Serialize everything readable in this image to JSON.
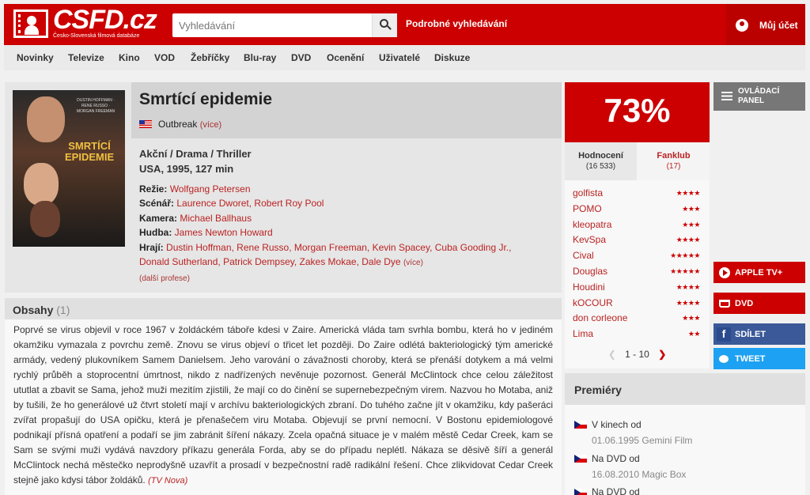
{
  "header": {
    "logo_text": "CSFD.cz",
    "logo_sub": "Česko-Slovenská filmová databáze",
    "search_placeholder": "Vyhledávání",
    "advanced_search": "Podrobné vyhledávání",
    "account": "Můj účet"
  },
  "nav": [
    "Novinky",
    "Televize",
    "Kino",
    "VOD",
    "Žebříčky",
    "Blu-ray",
    "DVD",
    "Ocenění",
    "Uživatelé",
    "Diskuze"
  ],
  "film": {
    "title": "Smrtící epidemie",
    "original_title": "Outbreak",
    "more": "(více)",
    "genre": "Akční / Drama / Thriller",
    "origin": "USA, 1995, 127 min",
    "poster": {
      "title": "SMRTÍCÍ EPIDEMIE",
      "names": "DUSTIN HOFFMAN · RENE RUSSO · MORGAN FREEMAN"
    },
    "crew": {
      "director_label": "Režie:",
      "director": "Wolfgang Petersen",
      "writer_label": "Scénář:",
      "writer": "Laurence Dworet, Robert Roy Pool",
      "camera_label": "Kamera:",
      "camera": "Michael Ballhaus",
      "music_label": "Hudba:",
      "music": "James Newton Howard",
      "cast_label": "Hrají:",
      "cast_line1": "Dustin Hoffman, Rene Russo, Morgan Freeman, Kevin Spacey, Cuba Gooding Jr.,",
      "cast_line2": "Donald Sutherland, Patrick Dempsey, Zakes Mokae, Dale Dye",
      "cast_more": "(více)",
      "more_professions": "(další profese)"
    }
  },
  "plot": {
    "heading": "Obsahy",
    "count": "(1)",
    "text": "Poprvé se virus objevil v roce 1967 v žoldáckém táboře kdesi v Zaire. Americká vláda tam svrhla bombu, která ho v jediném okamžiku vymazala z povrchu země. Znovu se virus objeví o třicet let později. Do Zaire odlétá bakteriologický tým americké armády, vedený plukovníkem Samem Danielsem. Jeho varování o závažnosti choroby, která se přenáší dotykem a má velmi rychlý průběh a stoprocentní úmrtnost, nikdo z nadřízených nevěnuje pozornost. Generál McClintock chce celou záležitost ututlat a zbavit se Sama, jehož muži mezitím zjistili, že mají co do činění se supernebezpečným virem. Nazvou ho Motaba, aniž by tušili, že ho generálové už čtvrt století mají v archívu bakteriologických zbraní. Do tuhého začne jít v okamžiku, kdy pašeráci zvířat propašují do USA opičku, která je přenašečem viru Motaba. Objevují se první nemocní. V Bostonu epidemiologové podnikají přísná opatření a podaří se jim zabránit šíření nákazy. Zcela opačná situace je v malém městě Cedar Creek, kam se Sam se svými muži vydává navzdory příkazu generála Forda, aby se do případu neplétl. Nákaza se děsivě šíří a generál McClintock nechá městečko neprodyšně uzavřít a prosadí v bezpečnostní radě radikální řešení. Chce zlikvidovat Cedar Creek stejně jako kdysi tábor žoldáků.",
    "source": "(TV Nova)"
  },
  "rating": {
    "percent": "73%",
    "tab_ratings": "Hodnocení",
    "tab_ratings_count": "(16 533)",
    "tab_fanclub": "Fanklub",
    "tab_fanclub_count": "(17)",
    "raters": [
      {
        "name": "golfista",
        "stars": 4
      },
      {
        "name": "POMO",
        "stars": 3
      },
      {
        "name": "kleopatra",
        "stars": 3
      },
      {
        "name": "KevSpa",
        "stars": 4
      },
      {
        "name": "Cival",
        "stars": 5
      },
      {
        "name": "Douglas",
        "stars": 5
      },
      {
        "name": "Houdini",
        "stars": 4
      },
      {
        "name": "kOCOUR",
        "stars": 4
      },
      {
        "name": "don corleone",
        "stars": 3
      },
      {
        "name": "Lima",
        "stars": 2
      }
    ],
    "pager": "1 - 10"
  },
  "premieres": {
    "heading": "Premiéry",
    "items": [
      {
        "title": "V kinech od",
        "date": "01.06.1995 Gemini Film"
      },
      {
        "title": "Na DVD od",
        "date": "16.08.2010 Magic Box"
      },
      {
        "title": "Na DVD od",
        "date": ""
      }
    ]
  },
  "side": {
    "control_panel": "OVLÁDACÍ PANEL",
    "apple_tv": "APPLE TV+",
    "dvd": "DVD",
    "share": "SDÍLET",
    "tweet": "TWEET"
  },
  "colors": {
    "brand": "#cc0000",
    "link": "#b22222",
    "facebook": "#3b5998",
    "twitter": "#1da1f2"
  }
}
